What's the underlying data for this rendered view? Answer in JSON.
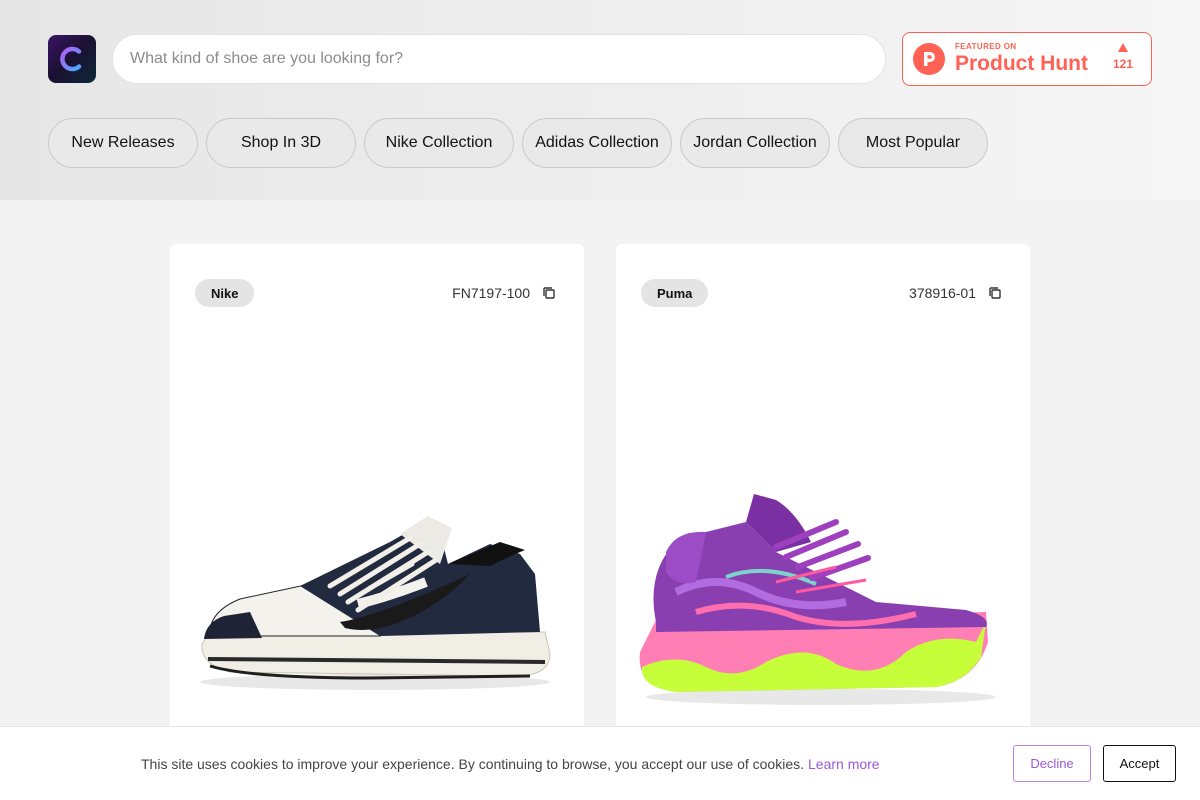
{
  "search": {
    "placeholder": "What kind of shoe are you looking for?"
  },
  "logo": {
    "icon": "letter-c-logo",
    "colors": [
      "#3a1566",
      "#7b3fe4",
      "#2fc1e0"
    ]
  },
  "product_hunt": {
    "featured": "FEATURED ON",
    "name": "Product Hunt",
    "votes": "121",
    "color": "#ff6154"
  },
  "nav": [
    {
      "label": "New Releases"
    },
    {
      "label": "Shop In 3D"
    },
    {
      "label": "Nike Collection"
    },
    {
      "label": "Adidas Collection"
    },
    {
      "label": "Jordan Collection"
    },
    {
      "label": "Most Popular"
    }
  ],
  "products": [
    {
      "brand": "Nike",
      "sku": "FN7197-100",
      "image": "nike-dunk-low-navy-white-sneaker"
    },
    {
      "brand": "Puma",
      "sku": "378916-01",
      "image": "puma-mb03-purple-pink-green-sneaker"
    }
  ],
  "cookie": {
    "text": "This site uses cookies to improve your experience. By continuing to browse, you accept our use of cookies.",
    "link": "Learn more",
    "decline": "Decline",
    "accept": "Accept",
    "accent": "#9b59d9"
  }
}
